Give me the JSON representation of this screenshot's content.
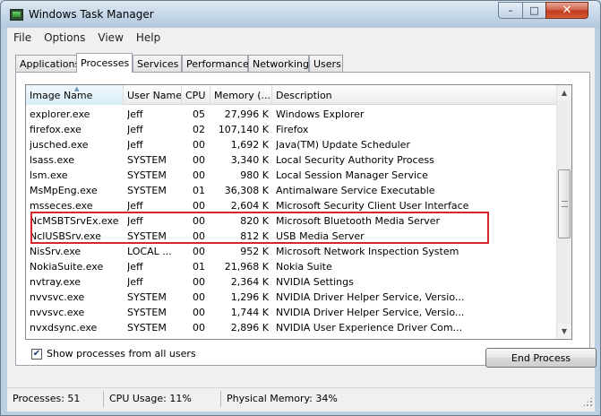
{
  "window": {
    "title": "Windows Task Manager",
    "close_glyph": "✕",
    "minimize_glyph": "–",
    "maximize_glyph": "□"
  },
  "menu": {
    "items": [
      "File",
      "Options",
      "View",
      "Help"
    ]
  },
  "tabs": {
    "items": [
      "Applications",
      "Processes",
      "Services",
      "Performance",
      "Networking",
      "Users"
    ],
    "active": "Processes"
  },
  "table": {
    "columns": [
      "Image Name",
      "User Name",
      "CPU",
      "Memory (...",
      "Description"
    ],
    "sorted_column": "Image Name",
    "rows": [
      {
        "name": "explorer.exe",
        "user": "Jeff",
        "cpu": "05",
        "mem": "27,996 K",
        "desc": "Windows Explorer"
      },
      {
        "name": "firefox.exe",
        "user": "Jeff",
        "cpu": "02",
        "mem": "107,140 K",
        "desc": "Firefox"
      },
      {
        "name": "jusched.exe",
        "user": "Jeff",
        "cpu": "00",
        "mem": "1,692 K",
        "desc": "Java(TM) Update Scheduler"
      },
      {
        "name": "lsass.exe",
        "user": "SYSTEM",
        "cpu": "00",
        "mem": "3,340 K",
        "desc": "Local Security Authority Process"
      },
      {
        "name": "lsm.exe",
        "user": "SYSTEM",
        "cpu": "00",
        "mem": "980 K",
        "desc": "Local Session Manager Service"
      },
      {
        "name": "MsMpEng.exe",
        "user": "SYSTEM",
        "cpu": "01",
        "mem": "36,308 K",
        "desc": "Antimalware Service Executable"
      },
      {
        "name": "msseces.exe",
        "user": "Jeff",
        "cpu": "00",
        "mem": "2,604 K",
        "desc": "Microsoft Security Client User Interface"
      },
      {
        "name": "NcMSBTSrvEx.exe",
        "user": "Jeff",
        "cpu": "00",
        "mem": "820 K",
        "desc": "Microsoft Bluetooth Media Server"
      },
      {
        "name": "NclUSBSrv.exe",
        "user": "SYSTEM",
        "cpu": "00",
        "mem": "812 K",
        "desc": "USB Media Server"
      },
      {
        "name": "NisSrv.exe",
        "user": "LOCAL ...",
        "cpu": "00",
        "mem": "952 K",
        "desc": "Microsoft Network Inspection System"
      },
      {
        "name": "NokiaSuite.exe",
        "user": "Jeff",
        "cpu": "01",
        "mem": "21,968 K",
        "desc": "Nokia Suite"
      },
      {
        "name": "nvtray.exe",
        "user": "Jeff",
        "cpu": "00",
        "mem": "2,364 K",
        "desc": "NVIDIA Settings"
      },
      {
        "name": "nvvsvc.exe",
        "user": "SYSTEM",
        "cpu": "00",
        "mem": "1,296 K",
        "desc": "NVIDIA Driver Helper Service, Versio..."
      },
      {
        "name": "nvvsvc.exe",
        "user": "SYSTEM",
        "cpu": "00",
        "mem": "1,744 K",
        "desc": "NVIDIA Driver Helper Service, Versio..."
      },
      {
        "name": "nvxdsync.exe",
        "user": "SYSTEM",
        "cpu": "00",
        "mem": "2,896 K",
        "desc": "NVIDIA User Experience Driver Com..."
      }
    ],
    "highlight_color": "#d9262c"
  },
  "controls": {
    "show_all_users_label": "Show processes from all users",
    "show_all_users_checked": true,
    "end_process_label": "End Process"
  },
  "status": {
    "processes": "Processes: 51",
    "cpu_usage": "CPU Usage: 11%",
    "physical_memory": "Physical Memory: 34%"
  }
}
